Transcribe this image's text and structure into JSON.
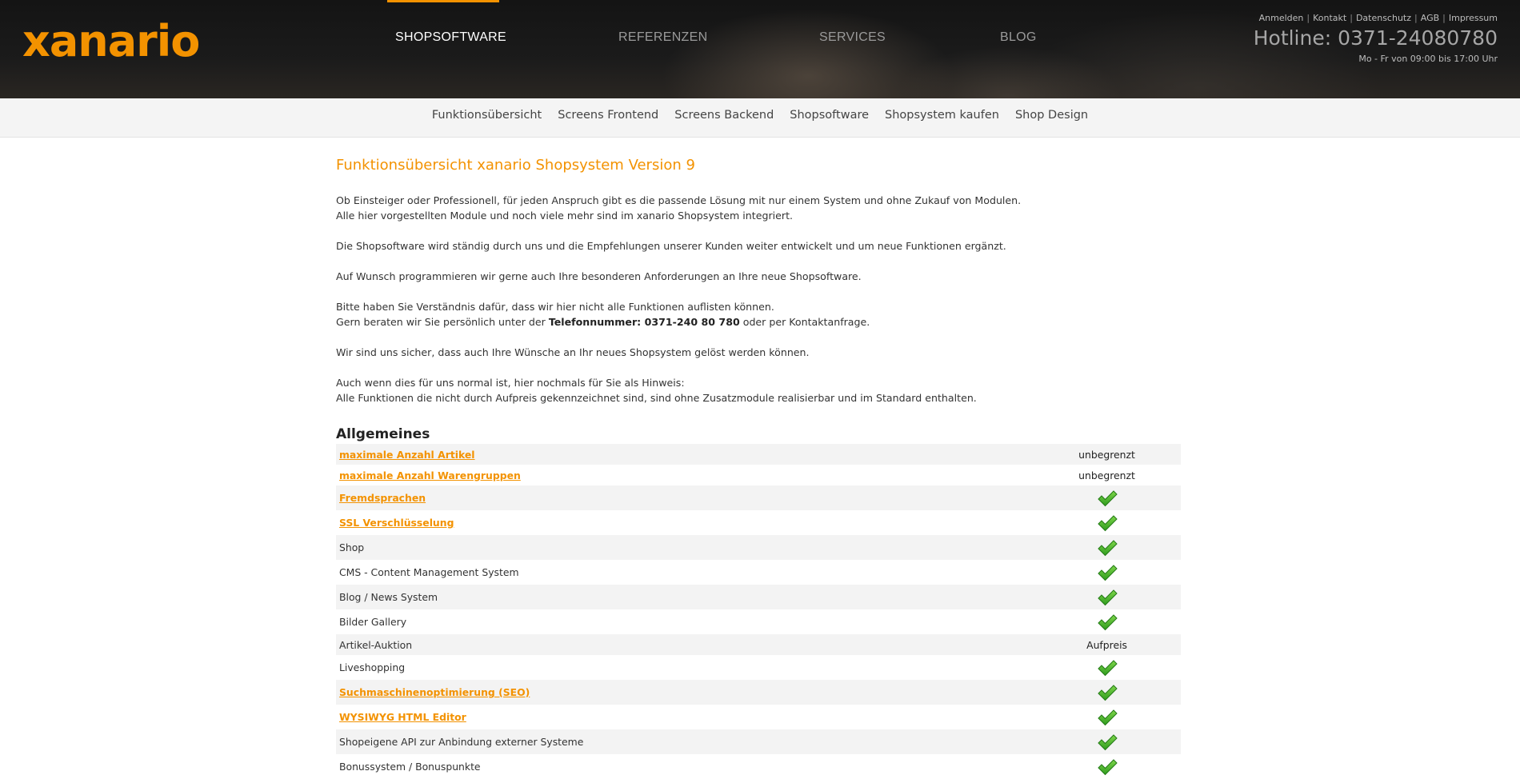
{
  "header": {
    "logo": "xanario",
    "nav": [
      {
        "label": "SHOPSOFTWARE",
        "active": true
      },
      {
        "label": "REFERENZEN",
        "active": false
      },
      {
        "label": "SERVICES",
        "active": false
      },
      {
        "label": "BLOG",
        "active": false
      }
    ],
    "toplinks": [
      "Anmelden",
      "Kontakt",
      "Datenschutz",
      "AGB",
      "Impressum"
    ],
    "hotline": "Hotline: 0371-24080780",
    "hours": "Mo - Fr von 09:00 bis 17:00 Uhr",
    "accent_color": "#f39200"
  },
  "subnav": [
    "Funktionsübersicht",
    "Screens Frontend",
    "Screens Backend",
    "Shopsoftware",
    "Shopsystem kaufen",
    "Shop Design"
  ],
  "main": {
    "title": "Funktionsübersicht xanario Shopsystem Version 9",
    "intro": {
      "p1_l1": "Ob Einsteiger oder Professionell, für jeden Anspruch gibt es die passende Lösung mit nur einem System und ohne Zukauf von Modulen.",
      "p1_l2": "Alle hier vorgestellten Module und noch viele mehr sind im xanario Shopsystem integriert.",
      "p2": "Die Shopsoftware wird ständig durch uns und die Empfehlungen unserer Kunden weiter entwickelt und um neue Funktionen ergänzt.",
      "p3": "Auf Wunsch programmieren wir gerne auch Ihre besonderen Anforderungen an Ihre neue Shopsoftware.",
      "p4_l1": "Bitte haben Sie Verständnis dafür, dass wir hier nicht alle Funktionen auflisten können.",
      "p4_l2_pre": "Gern beraten wir Sie persönlich unter der ",
      "p4_l2_bold": "Telefonnummer: 0371-240 80 780",
      "p4_l2_post": " oder per Kontaktanfrage.",
      "p5": "Wir sind uns sicher, dass auch Ihre Wünsche an Ihr neues Shopsystem gelöst werden können.",
      "p6_l1": "Auch wenn dies für uns normal ist, hier nochmals für Sie als Hinweis:",
      "p6_l2": "Alle Funktionen die nicht durch Aufpreis gekennzeichnet sind, sind ohne Zusatzmodule realisierbar und im Standard enthalten."
    },
    "section": "Allgemeines",
    "features": [
      {
        "name": "maximale Anzahl Artikel",
        "link": true,
        "value": "unbegrenzt"
      },
      {
        "name": "maximale Anzahl Warengruppen",
        "link": true,
        "value": "unbegrenzt"
      },
      {
        "name": "Fremdsprachen",
        "link": true,
        "value": "check"
      },
      {
        "name": "SSL Verschlüsselung",
        "link": true,
        "value": "check"
      },
      {
        "name": "Shop",
        "link": false,
        "value": "check"
      },
      {
        "name": "CMS - Content Management System",
        "link": false,
        "value": "check"
      },
      {
        "name": "Blog / News System",
        "link": false,
        "value": "check"
      },
      {
        "name": "Bilder Gallery",
        "link": false,
        "value": "check"
      },
      {
        "name": "Artikel-Auktion",
        "link": false,
        "value": "Aufpreis"
      },
      {
        "name": "Liveshopping",
        "link": false,
        "value": "check"
      },
      {
        "name": "Suchmaschinenoptimierung (SEO)",
        "link": true,
        "value": "check"
      },
      {
        "name": "WYSIWYG HTML Editor",
        "link": true,
        "value": "check"
      },
      {
        "name": "Shopeigene API zur Anbindung externer Systeme",
        "link": false,
        "value": "check"
      },
      {
        "name": "Bonussystem / Bonuspunkte",
        "link": false,
        "value": "check"
      }
    ],
    "check_icon": "green-checkmark-icon"
  }
}
